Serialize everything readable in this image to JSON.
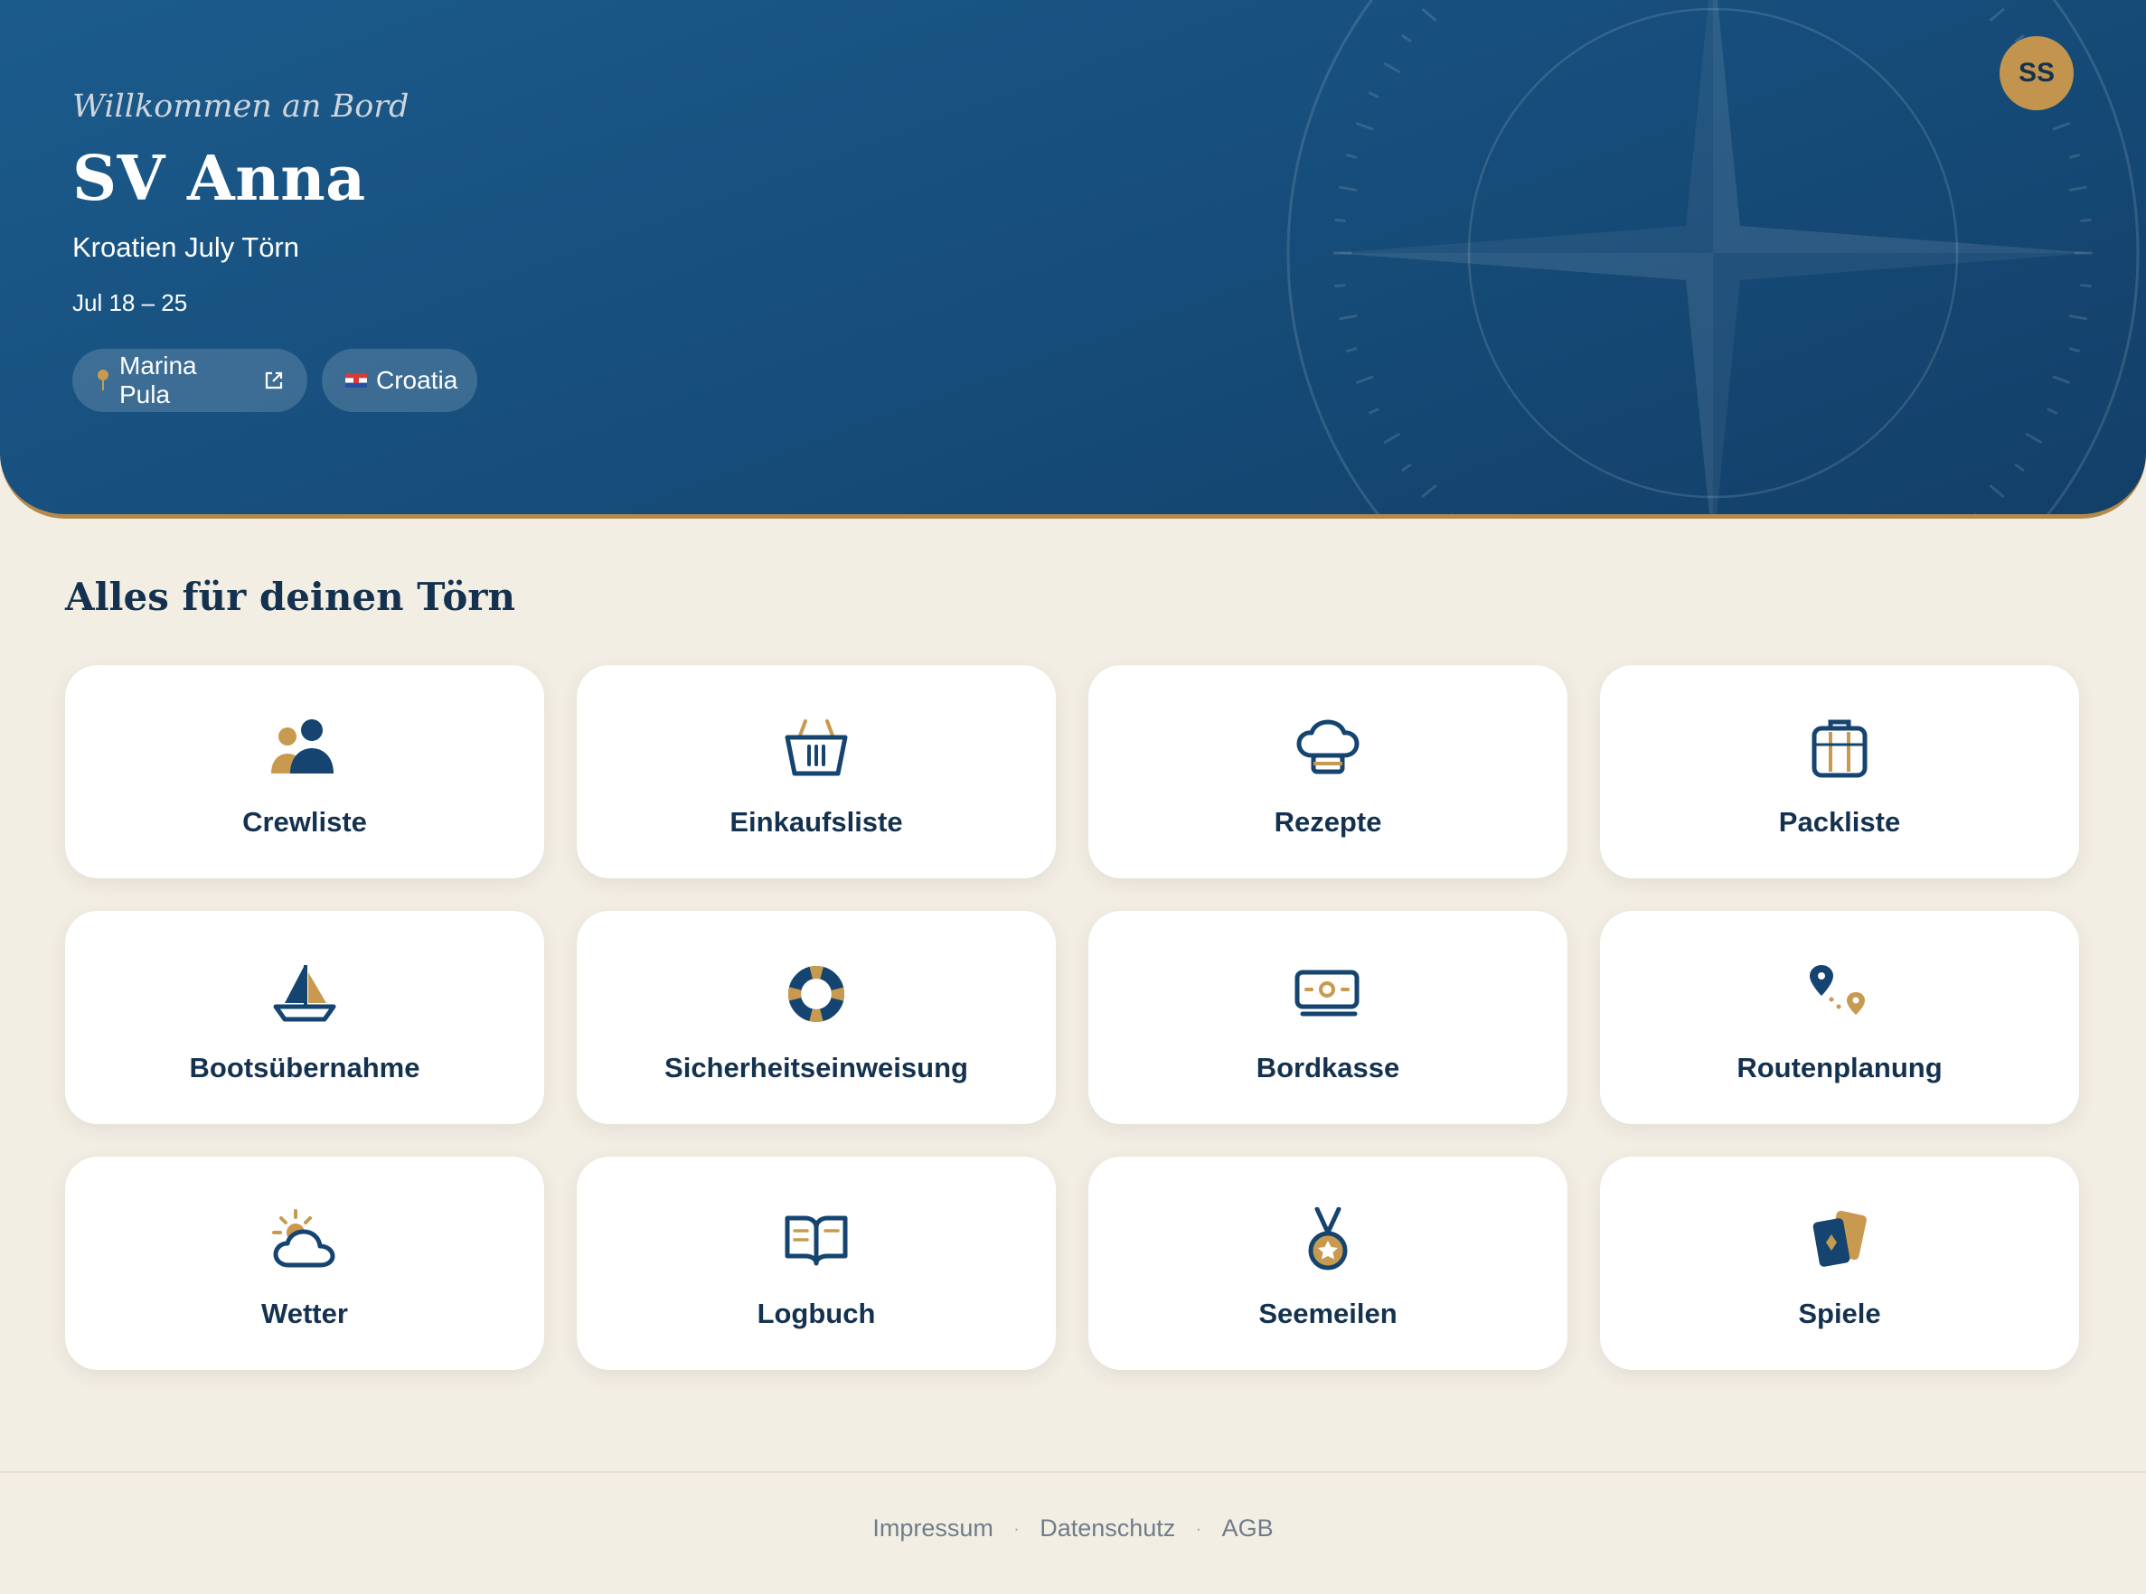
{
  "header": {
    "welcome": "Willkommen an Bord",
    "boat_name": "SV Anna",
    "trip_name": "Kroatien July Törn",
    "dates": "Jul 18 – 25",
    "marina_chip": {
      "label": "Marina Pula",
      "icon": "map-pin-icon",
      "trailing_icon": "external-link-icon"
    },
    "country_chip": {
      "label": "Croatia",
      "icon": "croatia-flag-icon"
    },
    "avatar_initials": "SS",
    "colors": {
      "hero": "#174f7d",
      "accent": "#b48a4b",
      "avatar": "#c2944e"
    }
  },
  "section": {
    "title": "Alles für deinen Törn"
  },
  "tiles": [
    {
      "label": "Crewliste",
      "icon": "crew-icon"
    },
    {
      "label": "Einkaufsliste",
      "icon": "basket-icon"
    },
    {
      "label": "Rezepte",
      "icon": "chef-hat-icon"
    },
    {
      "label": "Packliste",
      "icon": "suitcase-icon"
    },
    {
      "label": "Bootsübernahme",
      "icon": "sailboat-icon"
    },
    {
      "label": "Sicherheitseinweisung",
      "icon": "lifebuoy-icon"
    },
    {
      "label": "Bordkasse",
      "icon": "cash-icon"
    },
    {
      "label": "Routenplanung",
      "icon": "route-icon"
    },
    {
      "label": "Wetter",
      "icon": "weather-icon"
    },
    {
      "label": "Logbuch",
      "icon": "book-icon"
    },
    {
      "label": "Seemeilen",
      "icon": "medal-icon"
    },
    {
      "label": "Spiele",
      "icon": "cards-icon"
    }
  ],
  "footer": {
    "links": [
      "Impressum",
      "Datenschutz",
      "AGB"
    ]
  }
}
